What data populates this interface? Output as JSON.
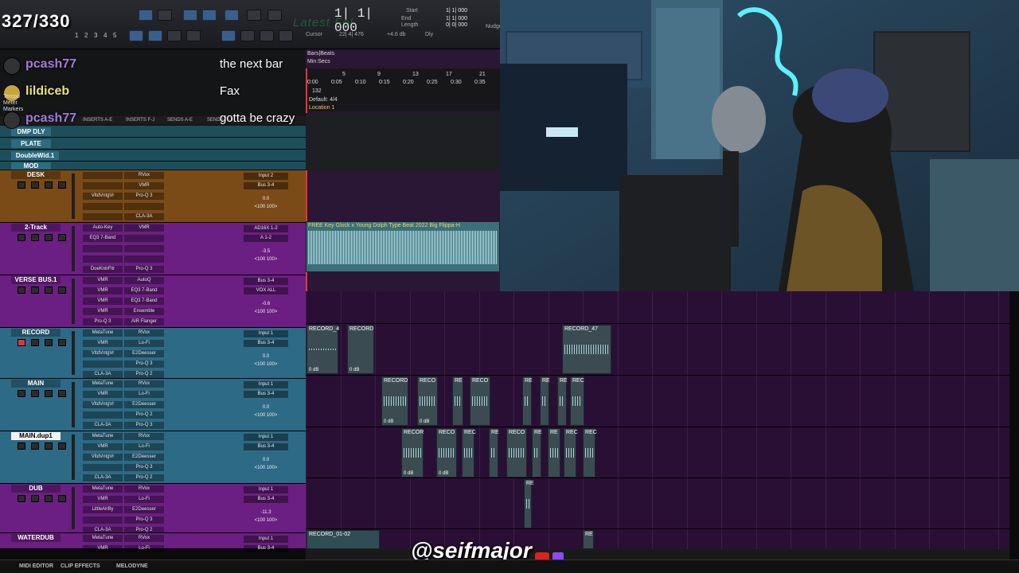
{
  "overlay": {
    "count": "327/330",
    "ghost_text": "Latest Fol"
  },
  "transport": {
    "counter": "1| 1| 000",
    "start_label": "Start",
    "end_label": "End",
    "length_label": "Length",
    "start_value": "1| 1| 000",
    "end_value": "1| 1| 000",
    "length_value": "0| 0| 000",
    "cursor_label": "Cursor",
    "cursor_value": "22| 4| 476",
    "db_value": "+4.6 db",
    "dly_label": "Dly",
    "nudge_label": "Nudge",
    "numbers": [
      "1",
      "2",
      "3",
      "4",
      "5"
    ]
  },
  "chat": [
    {
      "user": "pcash77",
      "message": "the next bar"
    },
    {
      "user": "lildiceb",
      "message": "Fax"
    },
    {
      "user": "pcash77",
      "message": "gotta be crazy"
    }
  ],
  "ruler": {
    "bars_beats_label": "Bars|Beats",
    "min_secs_label": "Min:Secs",
    "meter_label": "Meter",
    "tempo_label": "Tempo",
    "markers_label": "Markers",
    "bars": [
      "5",
      "9",
      "13",
      "17",
      "21"
    ],
    "times": [
      "0:00",
      "0:05",
      "0:10",
      "0:15",
      "0:20",
      "0:25",
      "0:30",
      "0:35"
    ],
    "tempo_value": "132",
    "meter_value": "Default: 4/4",
    "location": "Location 1"
  },
  "mix_header": {
    "inserts_ae": "INSERTS A-E",
    "inserts_fj": "INSERTS F-J",
    "sends_ae": "SENDS A-E",
    "sends_fj": "SENDS F-J"
  },
  "aux_tracks": [
    {
      "name": "DMP DLY"
    },
    {
      "name": "PLATE"
    },
    {
      "name": "DoubleWid.1"
    },
    {
      "name": "MOD"
    }
  ],
  "tracks": [
    {
      "name": "DESK",
      "color": "#7a4a17",
      "inserts": [
        "RVox",
        "VMR",
        "Pro-Q 3",
        "",
        "CLA-3A"
      ],
      "pre": [
        "",
        "",
        "VltdVntgVr",
        "",
        ""
      ],
      "io_in": "Input 2",
      "io_out": "Bus 3-4",
      "vol": "0.0",
      "pan": "<100  100>"
    },
    {
      "name": "2-Track",
      "color": "#6b1f82",
      "inserts": [
        "VMR",
        "",
        "",
        "",
        "Pro-Q 3"
      ],
      "pre": [
        "Auto-Key",
        "EQ3 7-Band",
        "",
        "",
        "DoeKnbFltr"
      ],
      "io_in": "AD16X 1-2",
      "io_out": "A 1-2",
      "vol": "-3.5",
      "pan": "<100  100>"
    },
    {
      "name": "VERSE BUS.1",
      "color": "#6b1f82",
      "inserts": [
        "AutoQ",
        "EQ3 7-Band",
        "EQ3 7-Band",
        "Ensemble",
        "AIR Flanger"
      ],
      "pre": [
        "VMR",
        "VMR",
        "VMR",
        "VMR",
        "Pro-Q 3"
      ],
      "io_in": "Bus 3-4",
      "io_out": "VOX ALL",
      "vol": "-0.6",
      "pan": "<100  100>"
    },
    {
      "name": "RECORD",
      "color": "#2d6a85",
      "inserts": [
        "RVox",
        "Lo-Fi",
        "E2Deesser",
        "Pro-Q 3",
        "Pro-Q 2"
      ],
      "pre": [
        "MetaTune",
        "VMR",
        "VltdVntgVr",
        "",
        "CLA-3A"
      ],
      "io_in": "Input 1",
      "io_out": "Bus 3-4",
      "vol": "0.0",
      "pan": "<100  100>"
    },
    {
      "name": "MAIN",
      "color": "#2d6a85",
      "inserts": [
        "RVox",
        "Lo-Fi",
        "E2Deesser",
        "Pro-Q 2",
        "Pro-Q 3"
      ],
      "pre": [
        "MetaTune",
        "VMR",
        "VltdVntgVr",
        "",
        "CLA-3A"
      ],
      "io_in": "Input 1",
      "io_out": "Bus 3-4",
      "vol": "0.0",
      "pan": "<100  100>"
    },
    {
      "name": "MAIN.dup1",
      "color": "#2d6a85",
      "inserts": [
        "RVox",
        "Lo-Fi",
        "E2Deesser",
        "Pro-Q 3",
        "Pro-Q 2"
      ],
      "pre": [
        "MetaTune",
        "VMR",
        "VltdVntgVr",
        "",
        "CLA-3A"
      ],
      "io_in": "Input 1",
      "io_out": "Bus 3-4",
      "vol": "0.0",
      "pan": "<100  100>"
    },
    {
      "name": "DUB",
      "color": "#6b1f82",
      "inserts": [
        "RVox",
        "Lo-Fi",
        "E2Deesser",
        "Pro-Q 3",
        "Pro-Q 2"
      ],
      "pre": [
        "MetaTune",
        "VMR",
        "LittleAlrBy",
        "",
        "CLA-3A"
      ],
      "io_in": "Input 1",
      "io_out": "Bus 3-4",
      "vol": "-11.3",
      "pan": "<100  100>"
    },
    {
      "name": "WATERDUB",
      "color": "#6b1f82",
      "inserts": [
        "RVox",
        "Lo-Fi"
      ],
      "pre": [
        "MetaTune",
        "VMR"
      ],
      "io_in": "Input 1",
      "io_out": "Bus 3-4",
      "vol": "",
      "pan": ""
    }
  ],
  "clips": {
    "beat": "FREE Key Glock x Young Dolph Type Beat 2022 Big Flippa-H",
    "record_a": "RECORD_4",
    "record_b": "RECORD",
    "record_47": "RECORD_47",
    "main_1": "RECORD",
    "main_2": "RECO",
    "main_3": "RE",
    "main_4": "RECO",
    "main_5": "RE",
    "main_6": "RE",
    "main_7": "RE",
    "main_8": "REC",
    "dup_1": "RECOR",
    "dup_2": "RECO",
    "dup_3": "REC",
    "dup_4": "RE",
    "dup_5": "RECO",
    "dup_6": "RE",
    "dup_7": "RE",
    "dup_8": "REC",
    "dup_9": "REC",
    "dub_1": "RE",
    "waterdub_1": "RECORD_01-02",
    "waterdub_2": "RE",
    "gain": "0 dB"
  },
  "bottom_bar": {
    "midi_editor": "MIDI EDITOR",
    "clip_effects": "CLIP EFFECTS",
    "melodyne": "MELODYNE"
  },
  "social": {
    "handle": "@seifmajor"
  }
}
